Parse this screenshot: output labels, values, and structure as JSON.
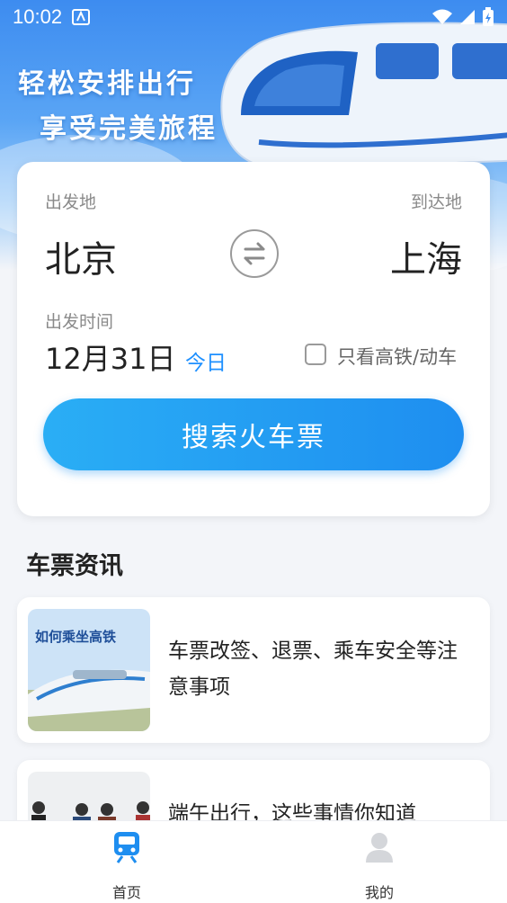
{
  "status_bar": {
    "time": "10:02"
  },
  "banner": {
    "line1": "轻松安排出行",
    "line2": "享受完美旅程"
  },
  "search": {
    "from_label": "出发地",
    "to_label": "到达地",
    "from_city": "北京",
    "to_city": "上海",
    "date_label": "出发时间",
    "date_value": "12月31日",
    "today_tag": "今日",
    "high_speed_only_label": "只看高铁/动车",
    "high_speed_only_checked": false,
    "search_button": "搜索火车票"
  },
  "news": {
    "title": "车票资讯",
    "items": [
      {
        "thumb_text": "如何乘坐高铁",
        "text": "车票改签、退票、乘车安全等注意事项"
      },
      {
        "text": "端午出行，这些事情你知道"
      }
    ]
  },
  "nav": {
    "home": "首页",
    "mine": "我的"
  },
  "colors": {
    "accent": "#1e8ef0",
    "today": "#1e90ff",
    "banner": "#3d8cf0"
  }
}
